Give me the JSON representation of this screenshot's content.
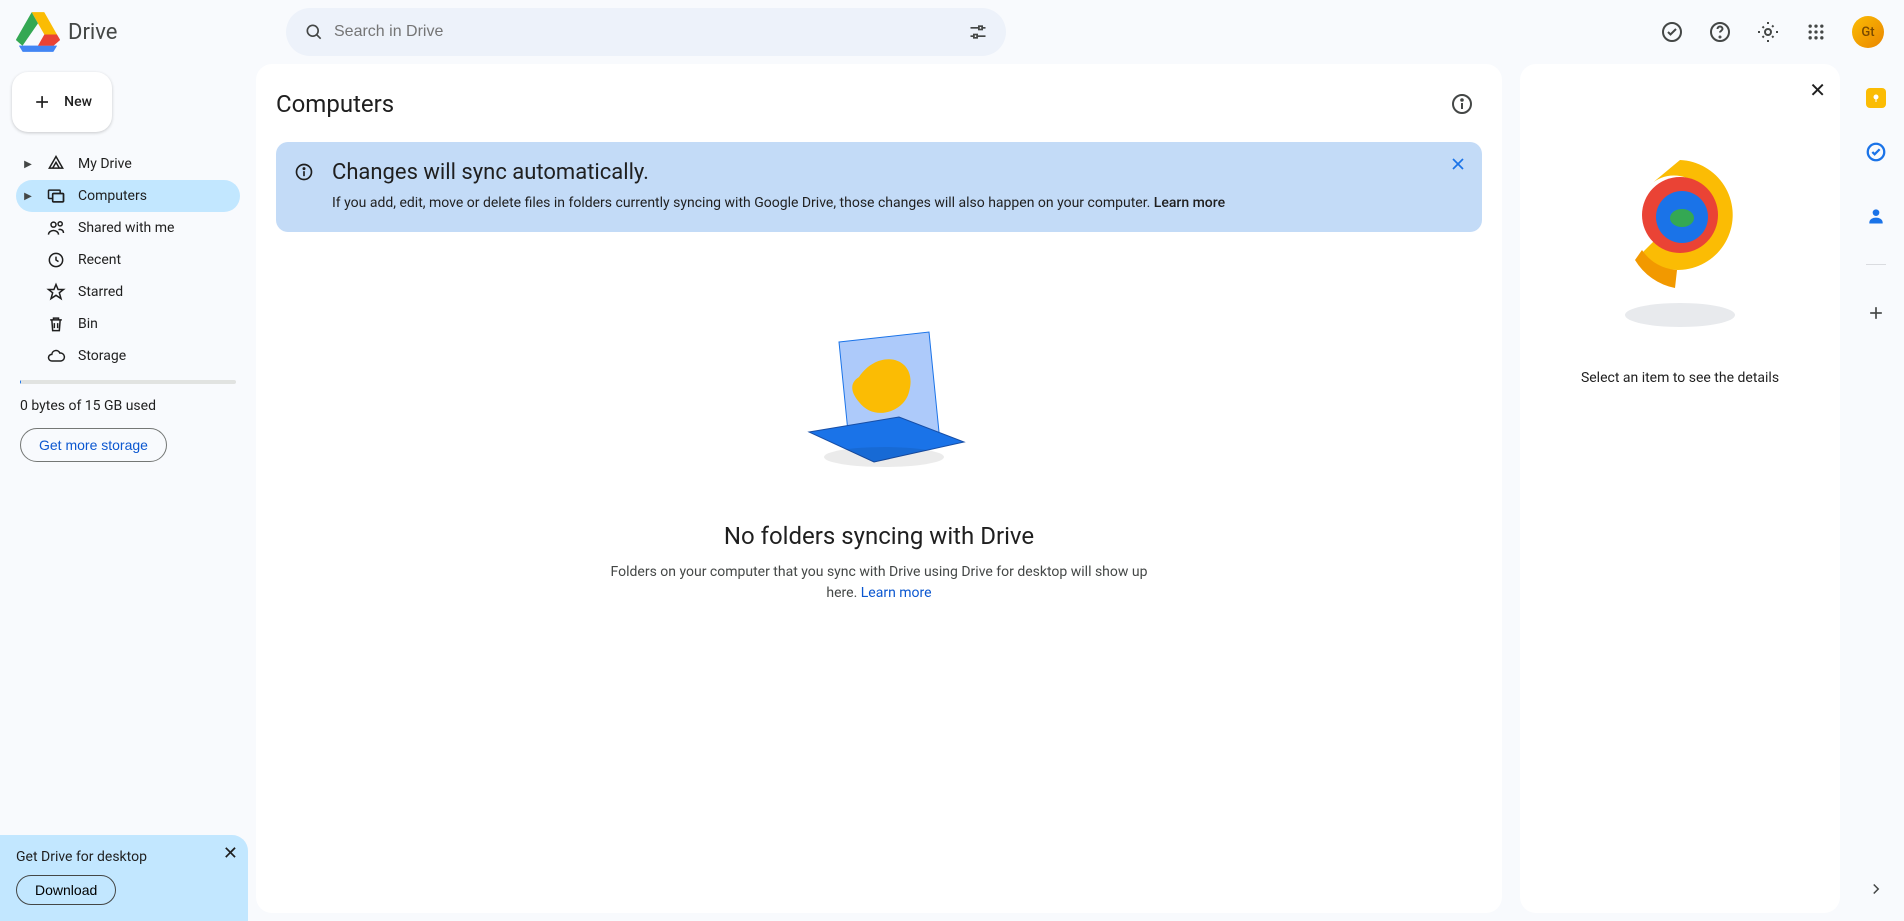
{
  "app": {
    "title": "Drive",
    "avatar_initials": "Gt"
  },
  "search": {
    "placeholder": "Search in Drive"
  },
  "new_button": "New",
  "sidebar": {
    "items": [
      {
        "label": "My Drive"
      },
      {
        "label": "Computers"
      },
      {
        "label": "Shared with me"
      },
      {
        "label": "Recent"
      },
      {
        "label": "Starred"
      },
      {
        "label": "Bin"
      },
      {
        "label": "Storage"
      }
    ],
    "storage_text": "0 bytes of 15 GB used",
    "get_storage": "Get more storage"
  },
  "desktop_promo": {
    "title": "Get Drive for desktop",
    "download": "Download"
  },
  "main": {
    "title": "Computers",
    "banner": {
      "title": "Changes will sync automatically.",
      "text": "If you add, edit, move or delete files in folders currently syncing with Google Drive, those changes will also happen on your computer. ",
      "learn_more": "Learn more"
    },
    "empty": {
      "title": "No folders syncing with Drive",
      "text": "Folders on your computer that you sync with Drive using Drive for desktop will show up here. ",
      "learn_more": "Learn more"
    }
  },
  "details": {
    "text": "Select an item to see the details"
  }
}
